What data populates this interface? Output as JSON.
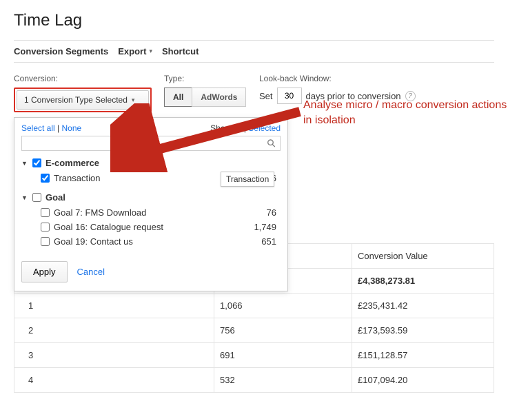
{
  "title": "Time Lag",
  "toolbar": {
    "segments": "Conversion Segments",
    "export": "Export",
    "shortcut": "Shortcut"
  },
  "filters": {
    "conversion_label": "Conversion:",
    "conversion_selected": "1 Conversion Type Selected",
    "type_label": "Type:",
    "type_all": "All",
    "type_adwords": "AdWords",
    "lookback_label": "Look-back Window:",
    "lookback_set": "Set",
    "lookback_value": "30",
    "lookback_suffix": "days prior to conversion"
  },
  "panel": {
    "select_all": "Select all",
    "none": "None",
    "show_all": "Show all",
    "selected": "Selected",
    "search_placeholder": "",
    "apply": "Apply",
    "cancel": "Cancel",
    "groups": [
      {
        "name": "E-commerce",
        "checked": true,
        "items": [
          {
            "name": "Transaction",
            "value": "40,606",
            "checked": true
          }
        ]
      },
      {
        "name": "Goal",
        "checked": false,
        "items": [
          {
            "name": "Goal 7: FMS Download",
            "value": "76",
            "checked": false
          },
          {
            "name": "Goal 16: Catalogue request",
            "value": "1,749",
            "checked": false
          },
          {
            "name": "Goal 19: Contact us",
            "value": "651",
            "checked": false
          }
        ]
      }
    ]
  },
  "tooltip": "Transaction",
  "annotation": "Analyse micro / macro conversion actions in isolation",
  "table": {
    "col_value": "Conversion Value",
    "rows": [
      {
        "n": "",
        "a": "",
        "v": "£4,388,273.81"
      },
      {
        "n": "1",
        "a": "1,066",
        "v": "£235,431.42"
      },
      {
        "n": "2",
        "a": "756",
        "v": "£173,593.59"
      },
      {
        "n": "3",
        "a": "691",
        "v": "£151,128.57"
      },
      {
        "n": "4",
        "a": "532",
        "v": "£107,094.20"
      }
    ]
  }
}
